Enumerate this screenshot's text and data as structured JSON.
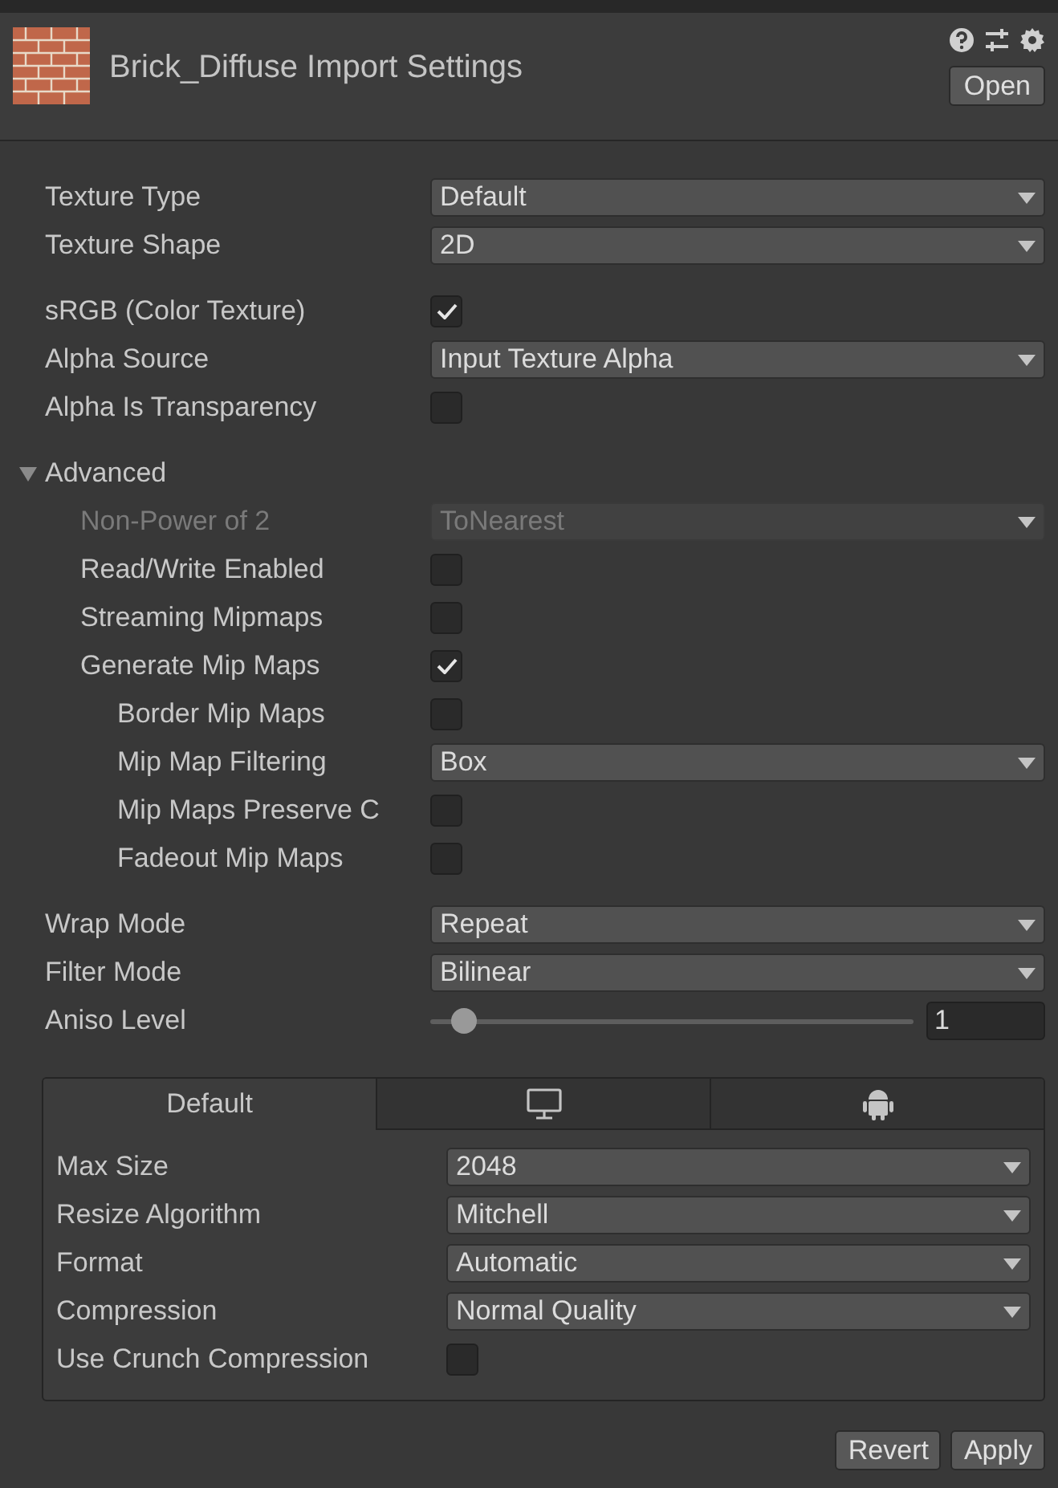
{
  "header": {
    "title": "Brick_Diffuse Import Settings",
    "open_button": "Open"
  },
  "groups": [
    {
      "rows": [
        {
          "kind": "dropdown",
          "label": "Texture Type",
          "value": "Default"
        },
        {
          "kind": "dropdown",
          "label": "Texture Shape",
          "value": "2D"
        }
      ]
    },
    {
      "rows": [
        {
          "kind": "checkbox",
          "label": "sRGB (Color Texture)",
          "checked": true
        },
        {
          "kind": "dropdown",
          "label": "Alpha Source",
          "value": "Input Texture Alpha"
        },
        {
          "kind": "checkbox",
          "label": "Alpha Is Transparency",
          "checked": false
        }
      ]
    },
    {
      "rows": [
        {
          "kind": "foldout",
          "label": "Advanced",
          "expanded": true,
          "children": [
            {
              "kind": "dropdown",
              "label": "Non-Power of 2",
              "value": "ToNearest",
              "disabled": true
            },
            {
              "kind": "checkbox",
              "label": "Read/Write Enabled",
              "checked": false
            },
            {
              "kind": "checkbox",
              "label": "Streaming Mipmaps",
              "checked": false
            },
            {
              "kind": "checkbox",
              "label": "Generate Mip Maps",
              "checked": true,
              "children": [
                {
                  "kind": "checkbox",
                  "label": "Border Mip Maps",
                  "checked": false
                },
                {
                  "kind": "dropdown",
                  "label": "Mip Map Filtering",
                  "value": "Box"
                },
                {
                  "kind": "checkbox",
                  "label": "Mip Maps Preserve C",
                  "checked": false
                },
                {
                  "kind": "checkbox",
                  "label": "Fadeout Mip Maps",
                  "checked": false
                }
              ]
            }
          ]
        }
      ]
    },
    {
      "rows": [
        {
          "kind": "dropdown",
          "label": "Wrap Mode",
          "value": "Repeat"
        },
        {
          "kind": "dropdown",
          "label": "Filter Mode",
          "value": "Bilinear"
        },
        {
          "kind": "slider",
          "label": "Aniso Level",
          "level": 0.07,
          "value": "1"
        }
      ]
    }
  ],
  "platforms": {
    "tabs": [
      {
        "kind": "text",
        "label": "Default",
        "selected": true
      },
      {
        "kind": "monitor",
        "selected": false
      },
      {
        "kind": "android",
        "selected": false
      }
    ],
    "rows": [
      {
        "kind": "dropdown",
        "label": "Max Size",
        "value": "2048"
      },
      {
        "kind": "dropdown",
        "label": "Resize Algorithm",
        "value": "Mitchell"
      },
      {
        "kind": "dropdown",
        "label": "Format",
        "value": "Automatic"
      },
      {
        "kind": "dropdown",
        "label": "Compression",
        "value": "Normal Quality"
      },
      {
        "kind": "checkbox",
        "label": "Use Crunch Compression",
        "checked": false
      }
    ]
  },
  "buttons": [
    "Revert",
    "Apply"
  ]
}
